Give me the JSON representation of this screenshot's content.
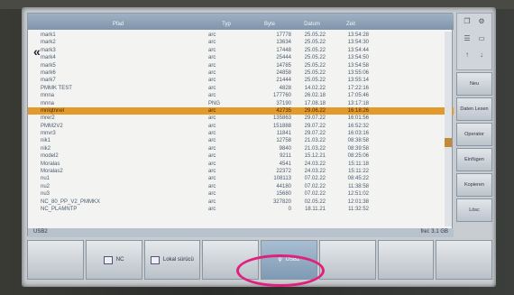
{
  "header": {
    "col_name": "Pfad",
    "col_typ": "Typ",
    "col_byte": "Byte",
    "col_date": "Datum",
    "col_time": "Zeit"
  },
  "files": [
    {
      "name": "mark1",
      "typ": "arc",
      "byte": "17778",
      "date": "25.05.22",
      "time": "13:54:28",
      "sel": false
    },
    {
      "name": "mark2",
      "typ": "arc",
      "byte": "13634",
      "date": "25.05.22",
      "time": "13:54:30",
      "sel": false
    },
    {
      "name": "mark3",
      "typ": "arc",
      "byte": "17448",
      "date": "25.05.22",
      "time": "13:54:44",
      "sel": false
    },
    {
      "name": "mark4",
      "typ": "arc",
      "byte": "25444",
      "date": "25.05.22",
      "time": "13:54:50",
      "sel": false
    },
    {
      "name": "mark5",
      "typ": "arc",
      "byte": "14785",
      "date": "25.05.22",
      "time": "13:54:58",
      "sel": false
    },
    {
      "name": "mark6",
      "typ": "arc",
      "byte": "24858",
      "date": "25.05.22",
      "time": "13:55:06",
      "sel": false
    },
    {
      "name": "mark7",
      "typ": "arc",
      "byte": "21444",
      "date": "25.05.22",
      "time": "13:55:14",
      "sel": false
    },
    {
      "name": "PMMK TEST",
      "typ": "arc",
      "byte": "4828",
      "date": "14.02.22",
      "time": "17:22:16",
      "sel": false
    },
    {
      "name": "mnna",
      "typ": "arc",
      "byte": "177760",
      "date": "26.02.18",
      "time": "17:05:46",
      "sel": false
    },
    {
      "name": "mnna",
      "typ": "PNG",
      "byte": "37190",
      "date": "17.08.18",
      "time": "13:17:18",
      "sel": false
    },
    {
      "name": "mnlqtnnel",
      "typ": "arc",
      "byte": "42735",
      "date": "29.06.22",
      "time": "16:18:26",
      "sel": true
    },
    {
      "name": "mrer2",
      "typ": "arc",
      "byte": "135863",
      "date": "29.07.22",
      "time": "16:01:56",
      "sel": false
    },
    {
      "name": "PMM2V2",
      "typ": "arc",
      "byte": "151888",
      "date": "29.07.22",
      "time": "16:52:32",
      "sel": false
    },
    {
      "name": "mnvr3",
      "typ": "arc",
      "byte": "11841",
      "date": "29.07.22",
      "time": "16:03:16",
      "sel": false
    },
    {
      "name": "nik1",
      "typ": "arc",
      "byte": "12758",
      "date": "21.03.22",
      "time": "08:38:58",
      "sel": false
    },
    {
      "name": "nik2",
      "typ": "arc",
      "byte": "9840",
      "date": "21.03.22",
      "time": "08:39:58",
      "sel": false
    },
    {
      "name": "model2",
      "typ": "arc",
      "byte": "9211",
      "date": "15.12.21",
      "time": "08:25:06",
      "sel": false
    },
    {
      "name": "Moralas",
      "typ": "arc",
      "byte": "4541",
      "date": "24.03.22",
      "time": "15:11:18",
      "sel": false
    },
    {
      "name": "Moralas2",
      "typ": "arc",
      "byte": "22372",
      "date": "24.03.22",
      "time": "15:11:22",
      "sel": false
    },
    {
      "name": "nu1",
      "typ": "arc",
      "byte": "108113",
      "date": "07.02.22",
      "time": "08:45:22",
      "sel": false
    },
    {
      "name": "nu2",
      "typ": "arc",
      "byte": "44180",
      "date": "07.02.22",
      "time": "11:38:58",
      "sel": false
    },
    {
      "name": "nu3",
      "typ": "arc",
      "byte": "15680",
      "date": "07.02.22",
      "time": "12:51:02",
      "sel": false
    },
    {
      "name": "NC_80_PP_V2_PMMKX",
      "typ": "arc",
      "byte": "327820",
      "date": "02.05.22",
      "time": "12:01:38",
      "sel": false
    },
    {
      "name": "NC_PLAMNTP",
      "typ": "arc",
      "byte": "0",
      "date": "18.11.21",
      "time": "11:32:52",
      "sel": false
    }
  ],
  "status": {
    "left": "USB2",
    "right": "frei: 3.1 GB"
  },
  "vertical_softkeys": [
    "Neu",
    "Daten Lesen",
    "Operator",
    "Einfügen",
    "Kopieren",
    "Lösc"
  ],
  "bottom_softkeys": {
    "nc": "NC",
    "lokal": "Lokal sürücü",
    "usb": "USB2"
  },
  "colors": {
    "selected_row": "#e49a2a",
    "highlight_ring": "#e0207a"
  }
}
